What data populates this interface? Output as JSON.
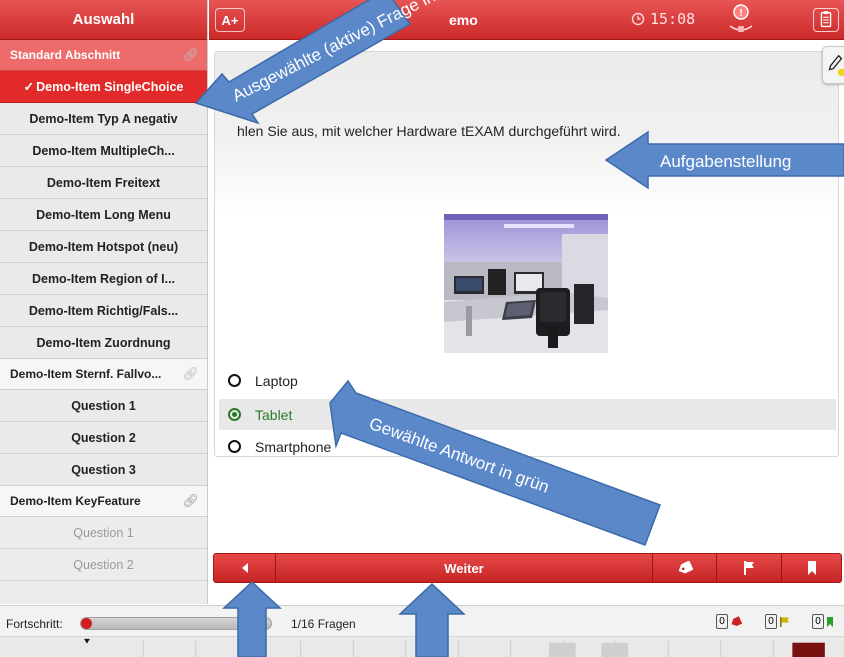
{
  "sidebar": {
    "header": "Auswahl",
    "sections": [
      {
        "label": "Standard Abschnitt"
      },
      {
        "label": "Demo-Item Sternf. Fallvo..."
      },
      {
        "label": "Demo-Item KeyFeature"
      }
    ],
    "items": [
      {
        "label": "Demo-Item SingleChoice"
      },
      {
        "label": "Demo-Item Typ A negativ"
      },
      {
        "label": "Demo-Item MultipleCh..."
      },
      {
        "label": "Demo-Item Freitext"
      },
      {
        "label": "Demo-Item Long Menu"
      },
      {
        "label": "Demo-Item Hotspot (neu)"
      },
      {
        "label": "Demo-Item Region of I..."
      },
      {
        "label": "Demo-Item Richtig/Fals..."
      },
      {
        "label": "Demo-Item Zuordnung"
      },
      {
        "label": "Question 1"
      },
      {
        "label": "Question 2"
      },
      {
        "label": "Question 3"
      },
      {
        "label": "Question 1"
      },
      {
        "label": "Question 2"
      }
    ]
  },
  "header": {
    "font_button": "A+",
    "title": "emo",
    "timer": "15:08"
  },
  "question": {
    "text": "hlen Sie aus, mit welcher Hardware tEXAM durchgeführt wird.",
    "options": [
      {
        "label": "Laptop",
        "selected": false
      },
      {
        "label": "Tablet",
        "selected": true
      },
      {
        "label": "Smartphone",
        "selected": false
      }
    ]
  },
  "nav": {
    "next_label": "Weiter"
  },
  "progress": {
    "label": "Fortschritt:",
    "count_text": "1/16 Fragen",
    "fraction": 0.0625,
    "tagged": "0",
    "flagged": "0",
    "marked": "0"
  },
  "annotations": {
    "active_question": "Ausgewählte (aktive) Frage in",
    "task": "Aufgabenstellung",
    "chosen_answer": "Gewählte Antwort in grün"
  },
  "colors": {
    "accent_red": "#d62c2c",
    "selected_green": "#2a7a2a",
    "annotation_blue": "#5b88c9"
  }
}
